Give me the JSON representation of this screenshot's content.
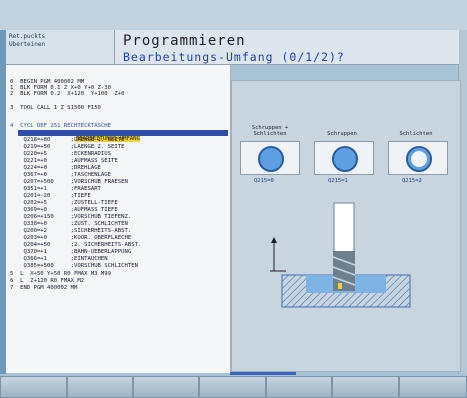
{
  "mode": {
    "line1": "Ret.puckts",
    "line2": "Uberteinen"
  },
  "header": {
    "title": "Programmieren",
    "question": "Bearbeitungs-Umfang (0/1/2)?"
  },
  "program": {
    "lines": [
      "0  BEGIN PGM 400002 MM",
      "1  BLK FORM 0.1 Z X+0 Y+0 Z-30",
      "2  BLK FORM 0.2  X+120  Y+100  Z+0",
      "",
      "3  TOOL CALL 1 Z S1500 F150",
      ""
    ],
    "selected_line": "4  CYCL DEF 251 RECHTECKTASCHE",
    "selected_code": "Q215=0",
    "selected_comment": "BEARBEITUNGS-UMFANG",
    "params": [
      "    Q218=+80      ;LAENGE 1. SEITE",
      "    Q219=+50      ;LAENGE 2. SEITE",
      "    Q220=+5       ;ECKENRADIUS",
      "    Q221=+0       ;AUFMASS SEITE",
      "    Q224=+0       ;DREHLAGE",
      "    Q367=+0       ;TASCHENLAGE",
      "    Q207=+500     ;VORSCHUB FRAESEN",
      "    Q351=+1       ;FRAESART",
      "    Q201=-20      ;TIEFE",
      "    Q202=+5       ;ZUSTELL-TIEFE",
      "    Q369=+0       ;AUFMASS TIEFE",
      "    Q206=+150     ;VORSCHUB TIEFENZ.",
      "    Q338=+0       ;ZUST. SCHLICHTEN",
      "    Q200=+2       ;SICHERHEITS-ABST.",
      "    Q203=+0       ;KOOR. OBERFLAECHE",
      "    Q204=+50      ;2. SICHERHEITS-ABST.",
      "    Q370=+1       ;BAHN-UEBERLAPPUNG",
      "    Q366=+1       ;EINTAUCHEN",
      "    Q385=+500     ;VORSCHUB SCHLICHTEN",
      "5  L  X+50 Y+50 R0 FMAX M3 M99",
      "6  L  Z+120 R0 FMAX M2",
      "7  END PGM 400002 MM"
    ]
  },
  "options": [
    {
      "label": "Schruppen +\nSchlichten",
      "code": "Q215=0",
      "style": "filled"
    },
    {
      "label": "Schruppen",
      "code": "Q215=1",
      "style": "filled"
    },
    {
      "label": "Schlichten",
      "code": "Q215=2",
      "style": "ring"
    }
  ],
  "softkeys": [
    "",
    "",
    "",
    "",
    "",
    "",
    ""
  ],
  "colors": {
    "accent_blue": "#1f3fb0",
    "selection_bar": "#2f4ea8",
    "highlight_yellow": "#f2d32c",
    "circle_fill": "#5d9fe0",
    "workpiece_hatch": "#3c6cb4"
  }
}
